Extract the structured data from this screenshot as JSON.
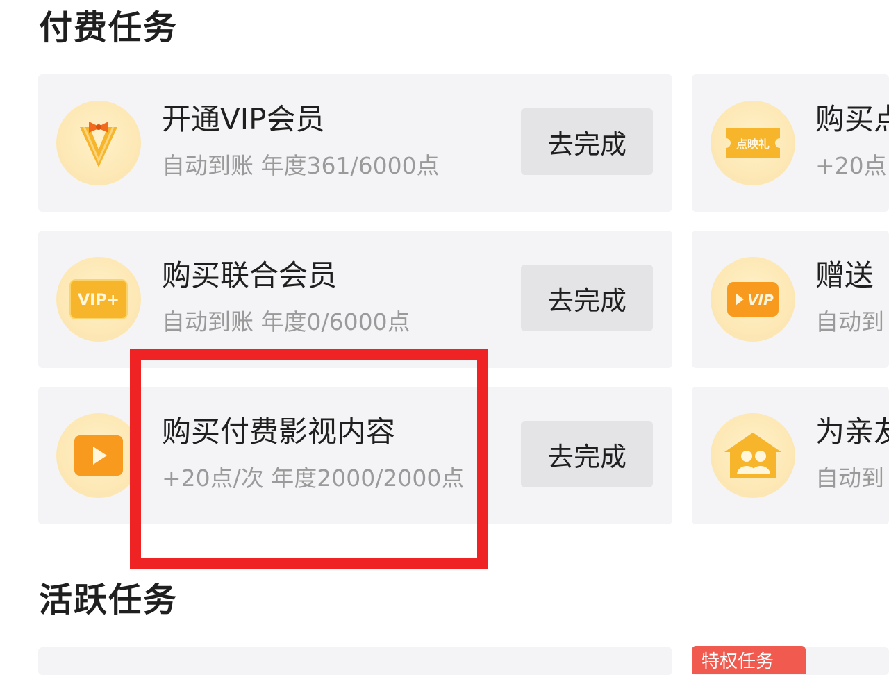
{
  "sections": {
    "paid_title": "付费任务",
    "active_title": "活跃任务"
  },
  "cards_left": [
    {
      "title": "开通VIP会员",
      "subtitle": "自动到账 年度361/6000点",
      "button": "去完成",
      "icon": "vip-bowtie-icon"
    },
    {
      "title": "购买联合会员",
      "subtitle": "自动到账 年度0/6000点",
      "button": "去完成",
      "icon": "vip-plus-icon",
      "icon_text": "VIP+"
    },
    {
      "title": "购买付费影视内容",
      "subtitle": "+20点/次 年度2000/2000点",
      "button": "去完成",
      "icon": "play-video-icon"
    }
  ],
  "cards_right": [
    {
      "title": "购买点",
      "subtitle": "+20点",
      "icon": "ticket-gift-icon",
      "icon_text": "点映礼"
    },
    {
      "title": "赠送",
      "subtitle": "自动到",
      "icon": "vip-play-icon",
      "icon_text": "VIP"
    },
    {
      "title": "为亲友",
      "subtitle": "自动到",
      "icon": "family-house-icon"
    }
  ],
  "active_tag": "特权任务",
  "colors": {
    "card_bg": "#f4f4f6",
    "button_bg": "#e4e4e6",
    "highlight": "#ef2323",
    "icon_gold": "#fbc531",
    "tag_red": "#f05a4f"
  }
}
